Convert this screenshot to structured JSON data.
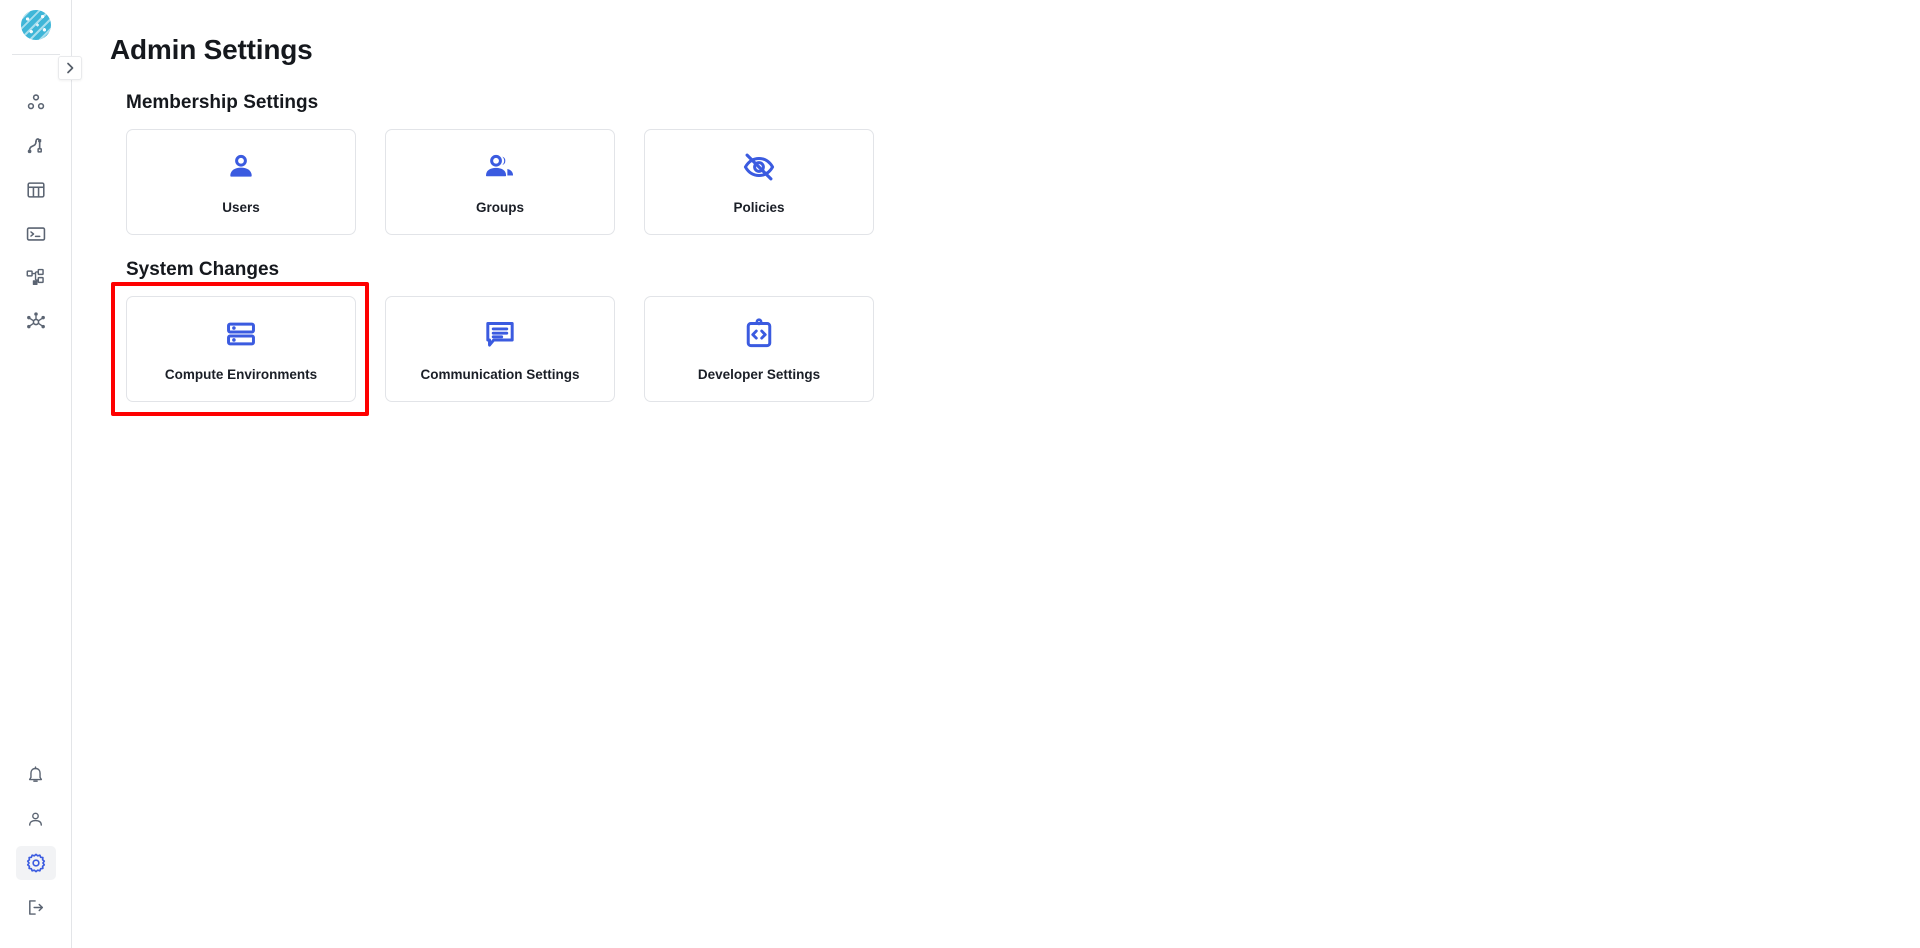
{
  "sidebar": {
    "logo_name": "circuit-globe-logo",
    "collapse_label": "›",
    "top_items": [
      {
        "name": "projects-icon",
        "label": "Projects"
      },
      {
        "name": "pipelines-icon",
        "label": "Pipelines"
      },
      {
        "name": "tables-icon",
        "label": "Tables"
      },
      {
        "name": "terminal-icon",
        "label": "Terminal"
      },
      {
        "name": "workflows-icon",
        "label": "Workflows"
      },
      {
        "name": "network-icon",
        "label": "Network"
      }
    ],
    "bottom_items": [
      {
        "name": "notifications-icon",
        "label": "Notifications",
        "active": false
      },
      {
        "name": "account-icon",
        "label": "Account",
        "active": false
      },
      {
        "name": "settings-gear-icon",
        "label": "Settings",
        "active": true
      },
      {
        "name": "logout-icon",
        "label": "Log out",
        "active": false
      }
    ]
  },
  "page": {
    "title": "Admin Settings"
  },
  "sections": [
    {
      "title": "Membership Settings",
      "cards": [
        {
          "label": "Users",
          "icon": "person-icon"
        },
        {
          "label": "Groups",
          "icon": "people-group-icon"
        },
        {
          "label": "Policies",
          "icon": "eye-off-icon"
        }
      ]
    },
    {
      "title": "System Changes",
      "cards": [
        {
          "label": "Compute Environments",
          "icon": "server-storage-icon"
        },
        {
          "label": "Communication Settings",
          "icon": "chat-bubble-icon"
        },
        {
          "label": "Developer Settings",
          "icon": "clipboard-code-icon"
        }
      ]
    }
  ],
  "annotation": {
    "highlight_color": "#fe0000",
    "highlight_target": "Compute Environments"
  },
  "colors": {
    "accent_blue": "#3b5be0",
    "logo_teal": "#3fb6d8",
    "text_dark": "#15181d",
    "border_gray": "#e2e4e8"
  }
}
